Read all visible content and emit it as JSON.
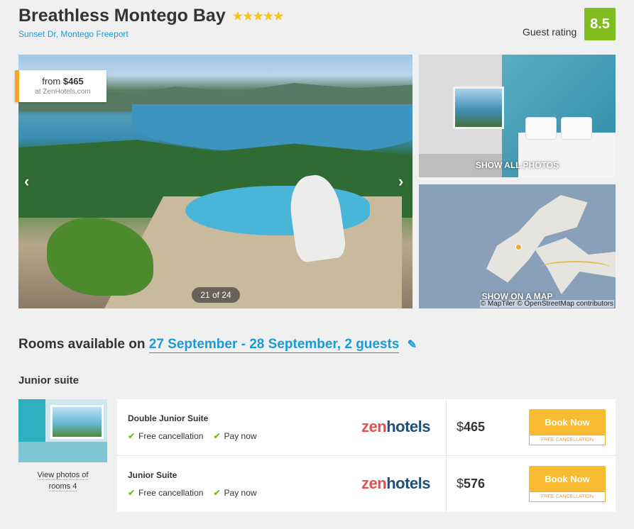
{
  "hotel": {
    "name": "Breathless Montego Bay",
    "stars": "★★★★★",
    "address": "Sunset Dr, Montego Freeport",
    "guest_rating_label": "Guest rating",
    "guest_rating": "8.5"
  },
  "gallery": {
    "price_from_label": "from",
    "price_from": "$465",
    "price_source": "at ZenHotels.com",
    "counter": "21 of 24",
    "prev_icon": "chevron-left-icon",
    "next_icon": "chevron-right-icon",
    "show_all_photos": "SHOW ALL PHOTOS",
    "show_on_map": "SHOW ON A MAP",
    "map_attribution": "© MapTiler © OpenStreetMap contributors"
  },
  "rooms": {
    "heading_prefix": "Rooms available on",
    "dates": "27 September - 28 September, 2 guests",
    "edit_icon": "pencil-icon",
    "room_type": "Junior suite",
    "view_photos_line1": "View photos of",
    "view_photos_line2": "rooms 4",
    "offers": [
      {
        "name": "Double Junior Suite",
        "perk1": "Free cancellation",
        "perk2": "Pay now",
        "provider_a": "zen",
        "provider_b": "hotels",
        "currency": "$",
        "price": "465",
        "book_label": "Book Now",
        "cancel_note": "FREE CANCELLATION"
      },
      {
        "name": "Junior Suite",
        "perk1": "Free cancellation",
        "perk2": "Pay now",
        "provider_a": "zen",
        "provider_b": "hotels",
        "currency": "$",
        "price": "576",
        "book_label": "Book Now",
        "cancel_note": "FREE CANCELLATION"
      }
    ]
  },
  "colors": {
    "accent_blue": "#1a9bd7",
    "rating_green": "#7fbc1e",
    "book_orange": "#f9bb32",
    "tag_orange": "#f5a623"
  }
}
